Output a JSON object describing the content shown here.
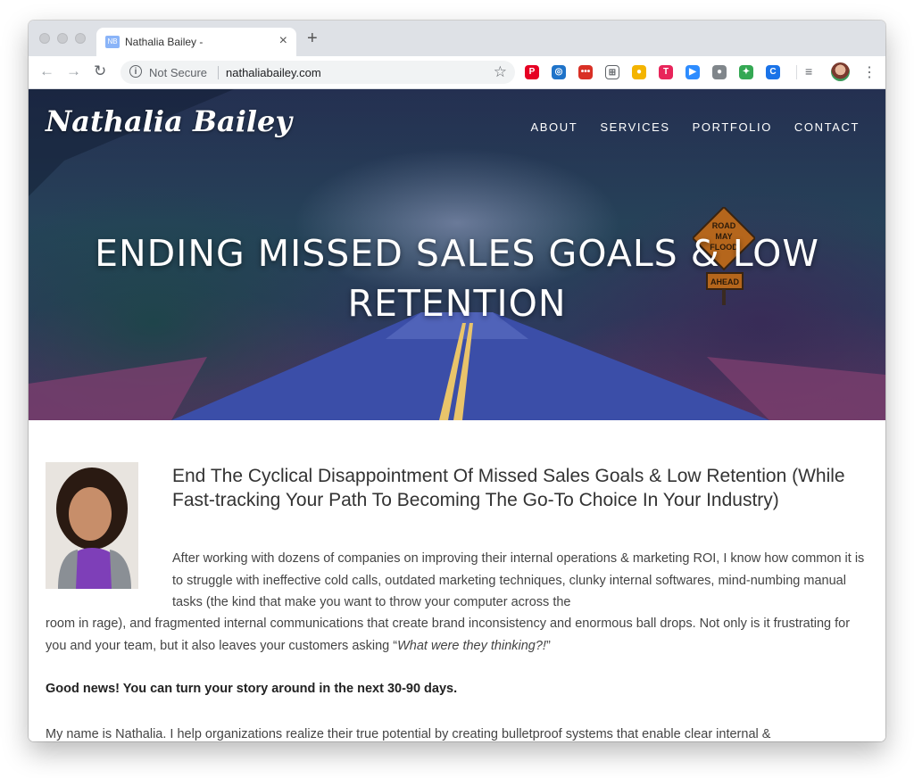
{
  "browser": {
    "tab": {
      "favicon_text": "NB",
      "title": "Nathalia Bailey -",
      "close": "×"
    },
    "new_tab": "+",
    "nav": {
      "back": "←",
      "forward": "→",
      "reload": "↻"
    },
    "omnibox": {
      "security_label": "Not Secure",
      "url": "nathaliabailey.com",
      "bookmark": "☆"
    },
    "extensions": [
      {
        "name": "pinterest-icon",
        "color": "#e60023",
        "glyph": "P"
      },
      {
        "name": "compass-icon",
        "color": "#1f73c9",
        "glyph": "◎"
      },
      {
        "name": "dots-icon",
        "color": "#d93025",
        "glyph": "•••"
      },
      {
        "name": "grid-icon",
        "color": "#ffffff",
        "glyph": "⊞"
      },
      {
        "name": "lightbulb-icon",
        "color": "#f4b400",
        "glyph": "●"
      },
      {
        "name": "target-icon",
        "color": "#e8245a",
        "glyph": "T"
      },
      {
        "name": "zoom-icon",
        "color": "#2d8cff",
        "glyph": "▶"
      },
      {
        "name": "circle-icon",
        "color": "#80868b",
        "glyph": "●"
      },
      {
        "name": "colorwheel-icon",
        "color": "#34a853",
        "glyph": "✦"
      },
      {
        "name": "c-icon",
        "color": "#1a73e8",
        "glyph": "C"
      }
    ],
    "menu": "⋮"
  },
  "site": {
    "logo": "Nathalia Bailey",
    "nav": [
      "ABOUT",
      "SERVICES",
      "PORTFOLIO",
      "CONTACT"
    ],
    "hero_heading_line1": "ENDING MISSED SALES GOALS & LOW",
    "hero_heading_line2": "RETENTION",
    "sign_line1": "ROAD",
    "sign_line2": "MAY",
    "sign_line3": "FLOOD",
    "sign_plate": "AHEAD"
  },
  "content": {
    "subheading": "End The Cyclical Disappointment Of Missed Sales Goals & Low Retention (While Fast-tracking Your Path To Becoming The Go-To Choice In Your Industry)",
    "p1_wrapped": "After working with dozens of companies on improving their internal operations & marketing ROI, I know how common it is to struggle with ineffective cold calls, outdated marketing techniques, clunky internal softwares, mind-numbing manual tasks (the kind that make you want to throw your computer across the",
    "p1_full": "room in rage), and fragmented internal communications that create brand inconsistency and enormous ball drops. Not only is it frustrating for you and your team, but it also leaves your customers asking “",
    "p1_quote": "What were they thinking?!",
    "p1_end": "”",
    "good_news": "Good news! You can turn your story around in the next 30-90 days.",
    "p3": "My name is Nathalia. I help organizations realize their true potential by creating bulletproof systems that enable clear internal &"
  }
}
